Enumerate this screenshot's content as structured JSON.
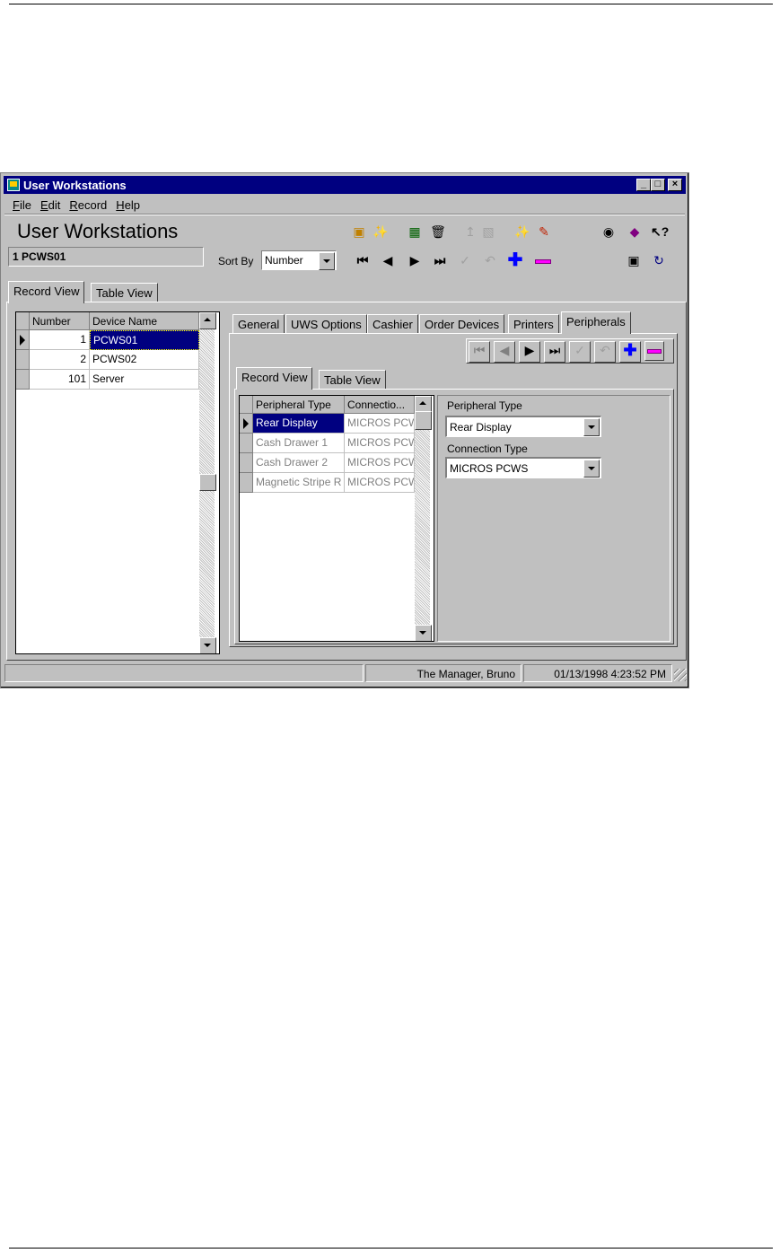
{
  "window": {
    "title": "User Workstations",
    "controls": {
      "minimize": "_",
      "maximize": "□",
      "close": "×"
    }
  },
  "menu": [
    {
      "label": "File",
      "key": "F",
      "rest": "ile"
    },
    {
      "label": "Edit",
      "key": "E",
      "rest": "dit"
    },
    {
      "label": "Record",
      "key": "R",
      "rest": "ecord"
    },
    {
      "label": "Help",
      "key": "H",
      "rest": "elp"
    }
  ],
  "header": {
    "title": "User Workstations",
    "current_record": "1 PCWS01",
    "sort_by_label": "Sort By",
    "sort_by_value": "Number"
  },
  "toolbar_icons": [
    "report-icon",
    "wizard-icon",
    "copy-record-icon",
    "delete-icon",
    "disabled-a-icon",
    "disabled-b-icon",
    "disabled-c-icon",
    "edit-icon",
    "find-icon",
    "book-icon",
    "whats-this-icon",
    "monitor-icon",
    "refresh-icon"
  ],
  "nav_icons": [
    "first-record-icon",
    "prev-record-icon",
    "next-record-icon",
    "last-record-icon",
    "confirm-icon",
    "undo-icon",
    "add-record-icon",
    "delete-record-icon"
  ],
  "accent_colors": {
    "selection": "#000080",
    "add": "#0000ff",
    "delete": "#ff00ff",
    "face": "#c0c0c0"
  },
  "view_tabs": [
    "Record View",
    "Table View"
  ],
  "left_grid": {
    "columns": [
      "Number",
      "Device Name"
    ],
    "rows": [
      {
        "number": "1",
        "name": "PCWS01",
        "selected": true
      },
      {
        "number": "2",
        "name": "PCWS02",
        "selected": false
      },
      {
        "number": "101",
        "name": "Server",
        "selected": false
      }
    ]
  },
  "detail_tabs": [
    "General",
    "UWS Options",
    "Cashier",
    "Order Devices",
    "Printers",
    "Peripherals"
  ],
  "active_detail_tab": "Peripherals",
  "inner_view_tabs": [
    "Record View",
    "Table View"
  ],
  "peripherals_grid": {
    "columns": [
      "Peripheral Type",
      "Connectio..."
    ],
    "rows": [
      {
        "type": "Rear Display",
        "connection": "MICROS PCW",
        "selected": true
      },
      {
        "type": "Cash Drawer 1",
        "connection": "MICROS PCW",
        "selected": false
      },
      {
        "type": "Cash Drawer 2",
        "connection": "MICROS PCW",
        "selected": false
      },
      {
        "type": "Magnetic Stripe R",
        "connection": "MICROS PCW",
        "selected": false
      }
    ]
  },
  "form": {
    "peripheral_type_label": "Peripheral Type",
    "peripheral_type_value": "Rear Display",
    "connection_type_label": "Connection Type",
    "connection_type_value": "MICROS PCWS"
  },
  "status_bar": {
    "user": "The Manager, Bruno",
    "datetime": "01/13/1998 4:23:52 PM"
  }
}
